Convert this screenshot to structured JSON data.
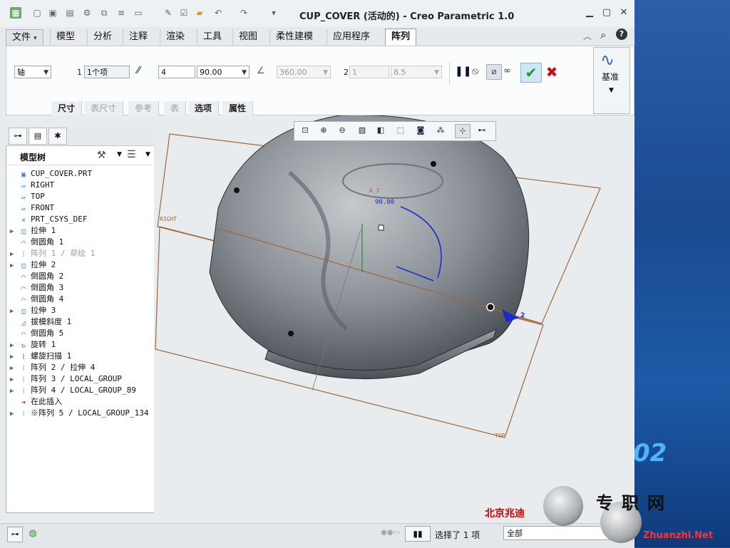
{
  "window": {
    "title": "CUP_COVER (活动的) - Creo Parametric 1.0"
  },
  "menu": {
    "tabs": [
      "文件",
      "模型",
      "分析",
      "注释",
      "渲染",
      "工具",
      "视图",
      "柔性建模",
      "应用程序",
      "阵列"
    ],
    "active_tab": "阵列"
  },
  "ribbon": {
    "pattern_type": "轴",
    "dir1_index": "1",
    "dir1_items": "1个项",
    "count_value": "4",
    "angle_value": "90.00",
    "total_angle": "360.00",
    "dir2_index": "2",
    "dir2_count": "1",
    "dir2_spacing": "8.5",
    "datum_label": "基准",
    "subtabs": [
      "尺寸",
      "表尺寸",
      "参考",
      "表",
      "选项",
      "属性"
    ]
  },
  "tree": {
    "header": "模型树",
    "items": [
      {
        "label": "CUP_COVER.PRT",
        "icon": "part-icon",
        "expand": ""
      },
      {
        "label": "RIGHT",
        "icon": "datum-plane-icon",
        "expand": ""
      },
      {
        "label": "TOP",
        "icon": "datum-plane-icon",
        "expand": ""
      },
      {
        "label": "FRONT",
        "icon": "datum-plane-icon",
        "expand": ""
      },
      {
        "label": "PRT_CSYS_DEF",
        "icon": "csys-icon",
        "expand": ""
      },
      {
        "label": "拉伸 1",
        "icon": "extrude-icon",
        "expand": "▶"
      },
      {
        "label": "倒圆角 1",
        "icon": "round-icon",
        "expand": ""
      },
      {
        "label": "阵列 1 / 草绘 1",
        "icon": "pattern-icon",
        "expand": "▶"
      },
      {
        "label": "拉伸 2",
        "icon": "extrude-icon",
        "expand": "▶"
      },
      {
        "label": "倒圆角 2",
        "icon": "round-icon",
        "expand": ""
      },
      {
        "label": "倒圆角 3",
        "icon": "round-icon",
        "expand": ""
      },
      {
        "label": "倒圆角 4",
        "icon": "round-icon",
        "expand": ""
      },
      {
        "label": "拉伸 3",
        "icon": "extrude-icon",
        "expand": "▶"
      },
      {
        "label": "拔模斜度 1",
        "icon": "draft-icon",
        "expand": ""
      },
      {
        "label": "倒圆角 5",
        "icon": "round-icon",
        "expand": ""
      },
      {
        "label": "旋转 1",
        "icon": "revolve-icon",
        "expand": "▶"
      },
      {
        "label": "螺旋扫描 1",
        "icon": "helical-sweep-icon",
        "expand": "▶"
      },
      {
        "label": "阵列 2 / 拉伸 4",
        "icon": "pattern-icon",
        "expand": "▶"
      },
      {
        "label": "阵列 3 / LOCAL_GROUP",
        "icon": "pattern-icon",
        "expand": "▶"
      },
      {
        "label": "阵列 4 / LOCAL_GROUP_89",
        "icon": "pattern-icon",
        "expand": "▶"
      },
      {
        "label": "在此插入",
        "icon": "insert-arrow-icon",
        "expand": ""
      },
      {
        "label": "※阵列 5 / LOCAL_GROUP_134",
        "icon": "pattern-icon",
        "expand": "▶"
      }
    ]
  },
  "graphics": {
    "plane_right": "RIGHT",
    "plane_top": "TOP",
    "dim_angle": "90.00",
    "dim_label": "A_2",
    "dir_label": "2"
  },
  "status": {
    "selection": "选择了 1 项",
    "filter": "全部"
  },
  "watermark": {
    "left_text": "北京兆迪",
    "brand": "专职网",
    "url": "Zhuanzhi.Net",
    "desk_number": "02"
  }
}
